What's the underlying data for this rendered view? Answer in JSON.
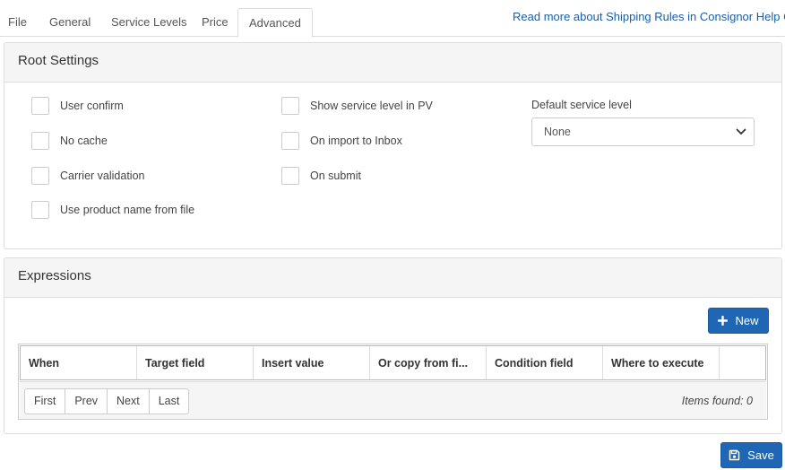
{
  "tabs": [
    {
      "label": "File"
    },
    {
      "label": "General"
    },
    {
      "label": "Service Levels"
    },
    {
      "label": "Price"
    },
    {
      "label": "Advanced",
      "active": true
    }
  ],
  "help_link": "Read more about Shipping Rules in Consignor Help Center",
  "root_settings": {
    "title": "Root Settings",
    "checkboxes_col1": [
      {
        "label": "User confirm",
        "checked": false
      },
      {
        "label": "No cache",
        "checked": false
      },
      {
        "label": "Carrier validation",
        "checked": false
      },
      {
        "label": "Use product name from file",
        "checked": false
      }
    ],
    "checkboxes_col2": [
      {
        "label": "Show service level in PV",
        "checked": false
      },
      {
        "label": "On import to Inbox",
        "checked": false
      },
      {
        "label": "On submit",
        "checked": false
      }
    ],
    "default_service_level": {
      "label": "Default service level",
      "value": "None"
    }
  },
  "expressions": {
    "title": "Expressions",
    "new_button": "New",
    "columns": [
      "When",
      "Target field",
      "Insert value",
      "Or copy from fi...",
      "Condition field",
      "Where to execute",
      ""
    ],
    "pager": [
      "First",
      "Prev",
      "Next",
      "Last"
    ],
    "items_found": "Items found: 0"
  },
  "save_button": "Save",
  "colors": {
    "primary": "#1f67b4",
    "link": "#1a5fa8",
    "panel_heading": "#f5f5f5",
    "border": "#dddddd"
  }
}
